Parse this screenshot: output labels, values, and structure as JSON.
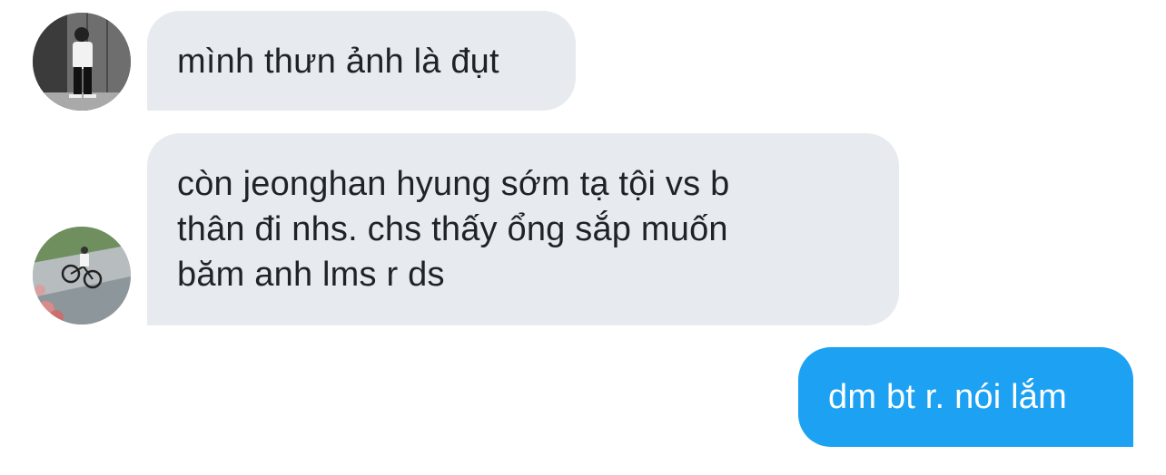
{
  "conversation": {
    "messages": [
      {
        "direction": "incoming",
        "avatar_icon": "bw-person-photo-avatar",
        "lines": [
          "mình thưn ảnh là đụt"
        ]
      },
      {
        "direction": "incoming",
        "avatar_icon": "bicycle-photo-avatar",
        "lines": [
          "còn jeonghan hyung sớm tạ tội vs b",
          "thân đi nhs. chs thấy ổng sắp muốn",
          "băm anh lms r ds"
        ]
      },
      {
        "direction": "outgoing",
        "lines": [
          "dm bt r. nói lắm"
        ]
      }
    ]
  },
  "colors": {
    "incoming_bubble": "#e7ebef",
    "outgoing_bubble": "#1da1f2",
    "incoming_text": "#1f2328",
    "outgoing_text": "#ffffff"
  }
}
